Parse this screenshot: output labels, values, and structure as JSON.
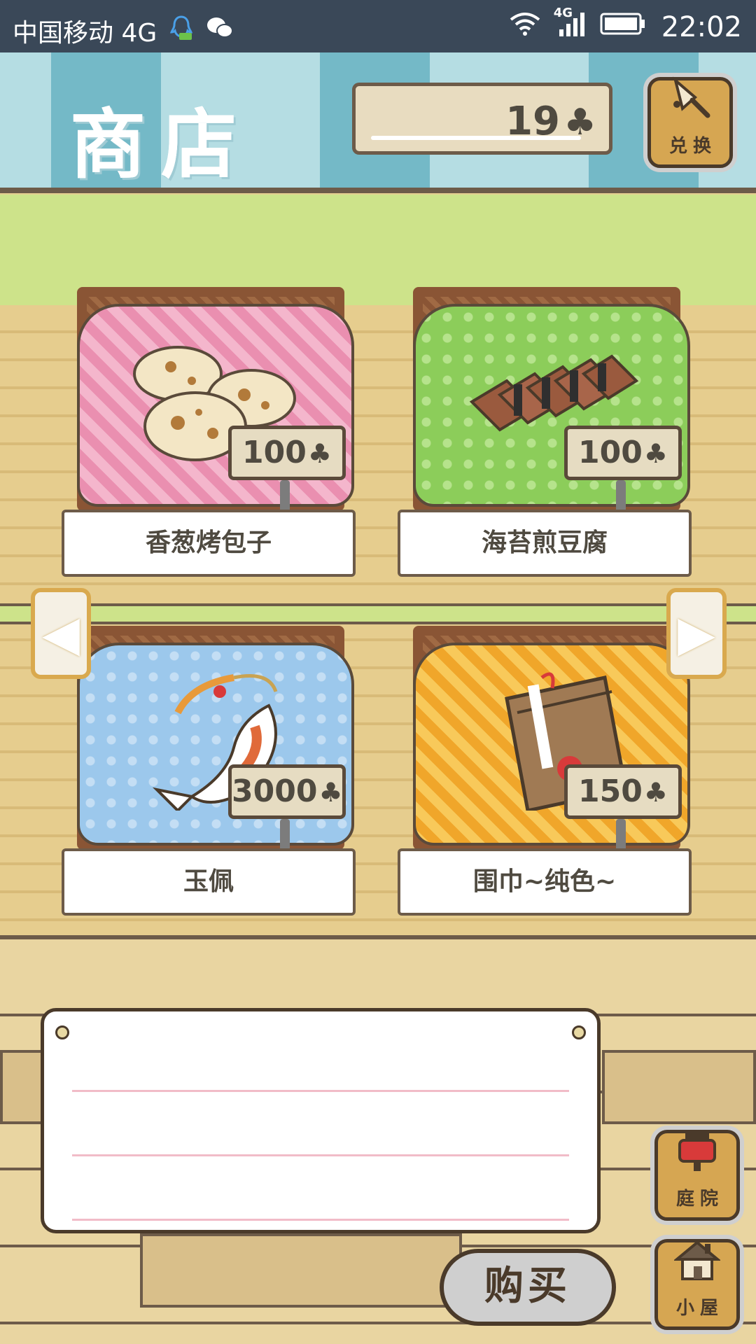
{
  "status_bar": {
    "carrier": "中国移动 4G",
    "network_badge": "4G",
    "time": "22:02",
    "icons": [
      "qq-icon",
      "wechat-icon",
      "wifi-icon",
      "signal-icon",
      "battery-icon"
    ]
  },
  "header": {
    "title": "商店",
    "currency_value": "19",
    "currency_icon": "clover-icon",
    "exchange_label": "兑换"
  },
  "items": [
    {
      "name": "香葱烤包子",
      "price": "100",
      "cloth": "#f2a6c2",
      "pattern": "plaid"
    },
    {
      "name": "海苔煎豆腐",
      "price": "100",
      "cloth": "#8ccd5a",
      "pattern": "dots"
    },
    {
      "name": "玉佩",
      "price": "3000",
      "cloth": "#9cc8ec",
      "pattern": "dots"
    },
    {
      "name": "围巾~纯色~",
      "price": "150",
      "cloth": "#f5b93a",
      "pattern": "plaid"
    }
  ],
  "buttons": {
    "buy": "购买",
    "yard": "庭院",
    "house": "小屋"
  },
  "colors": {
    "accent_wood": "#d6a652",
    "outline": "#4a3a2a",
    "shelf_green": "#cde38a"
  }
}
